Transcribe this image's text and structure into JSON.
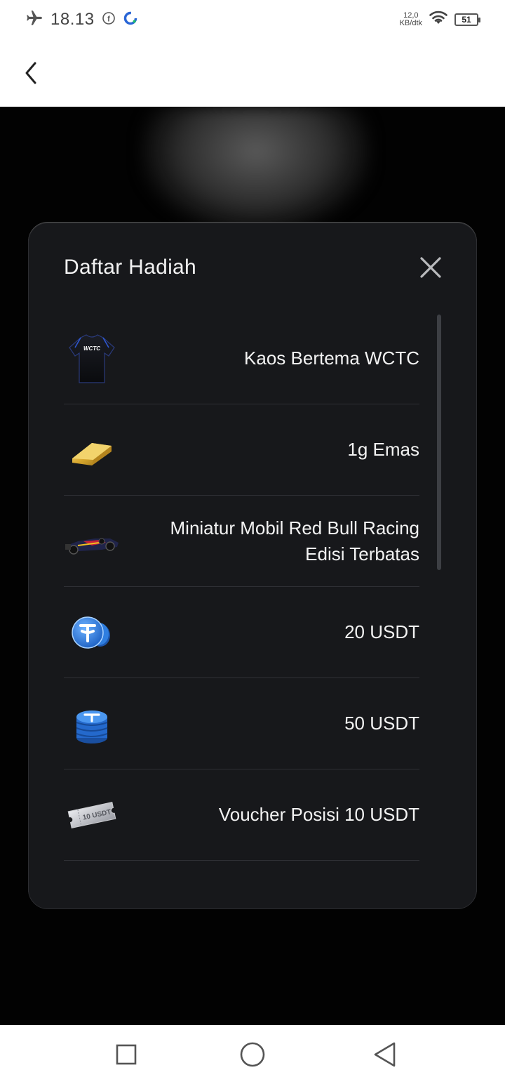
{
  "status_bar": {
    "time": "18.13",
    "net_speed_value": "12,0",
    "net_speed_unit": "KB/dtk",
    "battery": "51",
    "icons": [
      "airplane-icon",
      "facebook-icon",
      "app-c-icon",
      "wifi-icon",
      "battery-icon"
    ]
  },
  "header": {
    "back_icon": "chevron-left-icon"
  },
  "modal": {
    "title": "Daftar Hadiah",
    "close_icon": "close-icon",
    "prizes": [
      {
        "label": "Kaos Bertema WCTC",
        "icon": "tshirt-icon",
        "icon_text": "WCTC"
      },
      {
        "label": "1g Emas",
        "icon": "gold-bar-icon"
      },
      {
        "label_lines": [
          "Miniatur Mobil Red Bull Racing",
          "Edisi Terbatas"
        ],
        "icon": "race-car-icon"
      },
      {
        "label": "20 USDT",
        "icon": "usdt-coins-icon"
      },
      {
        "label": "50 USDT",
        "icon": "usdt-stack-icon"
      },
      {
        "label": "Voucher Posisi 10 USDT",
        "icon": "voucher-ticket-icon",
        "icon_text": "10 USDT"
      }
    ]
  },
  "nav_bar": {
    "icons": [
      "recents-square-icon",
      "home-circle-icon",
      "back-triangle-icon"
    ]
  },
  "colors": {
    "modal_bg": "#17181b",
    "backdrop": "#020202",
    "text": "#f2f2f2",
    "usdt_blue": "#2f7ee0",
    "gold": "#d9a82e"
  }
}
